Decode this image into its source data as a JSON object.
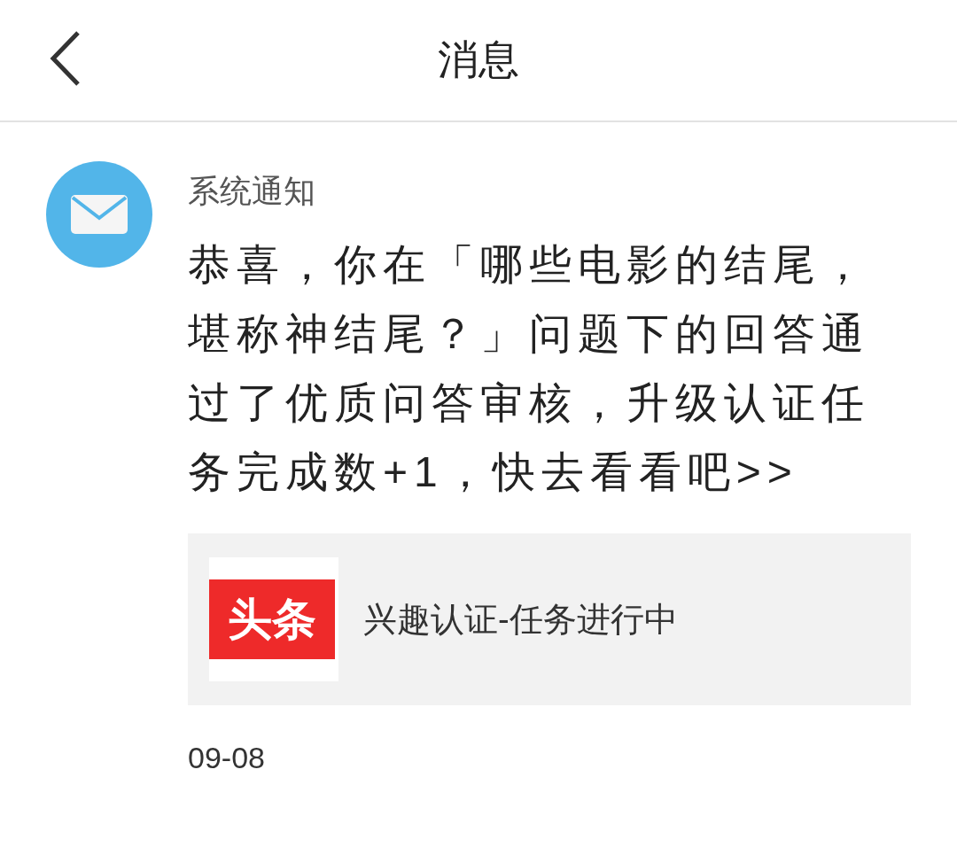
{
  "header": {
    "title": "消息"
  },
  "notification": {
    "sender": "系统通知",
    "message": "恭喜，你在「哪些电影的结尾，堪称神结尾？」问题下的回答通过了优质问答审核，升级认证任务完成数+1，快去看看吧>>",
    "card": {
      "logo_text": "头条",
      "title": "兴趣认证-任务进行中"
    },
    "date": "09-08"
  }
}
